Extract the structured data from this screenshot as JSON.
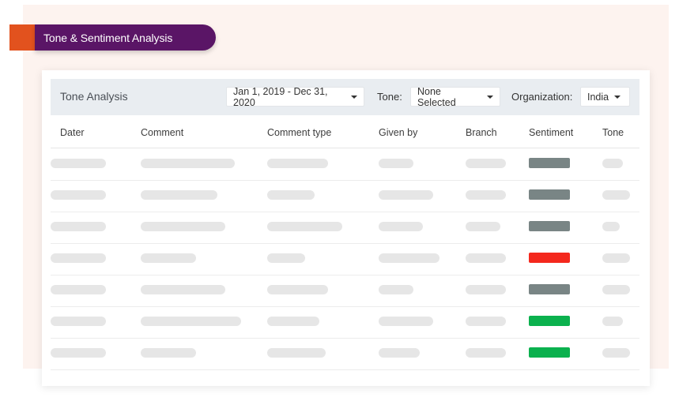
{
  "banner": {
    "title": "Tone & Sentiment Analysis"
  },
  "panel": {
    "title": "Tone Analysis",
    "date_range": "Jan 1, 2019 - Dec 31, 2020",
    "tone_label": "Tone:",
    "tone_value": "None Selected",
    "organization_label": "Organization:",
    "organization_value": "India"
  },
  "table": {
    "columns": [
      "Dater",
      "Comment",
      "Comment type",
      "Given by",
      "Branch",
      "Sentiment",
      "Tone"
    ],
    "rows": [
      {
        "sentiment": "neutral"
      },
      {
        "sentiment": "neutral"
      },
      {
        "sentiment": "neutral"
      },
      {
        "sentiment": "negative"
      },
      {
        "sentiment": "neutral"
      },
      {
        "sentiment": "positive"
      },
      {
        "sentiment": "positive"
      }
    ]
  },
  "colors": {
    "neutral": "#798585",
    "negative": "#f4281d",
    "positive": "#0bb14e",
    "brand": "#5a1566",
    "accent": "#e2521e"
  }
}
